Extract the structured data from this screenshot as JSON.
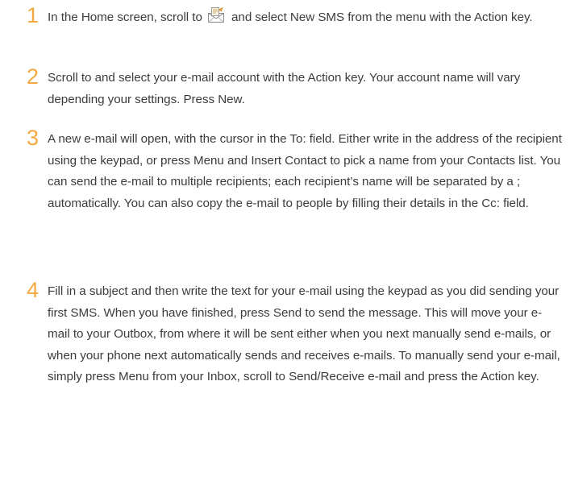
{
  "steps": [
    {
      "number": "1",
      "text_before_icon": "In the Home screen, scroll to",
      "icon": "envelope-icon",
      "text_after_icon": "and select New SMS from the menu with the Action key."
    },
    {
      "number": "2",
      "text": "Scroll to and select your e-mail account with the Action key. Your account name will vary depending your settings. Press New."
    },
    {
      "number": "3",
      "text": "A new e-mail will open, with the cursor in the To: field. Either write in the address of the recipient using the keypad, or press Menu and Insert Contact to pick a name from your Contacts list. You can send the e-mail to multiple recipients; each recipient’s name will be separated by a ; automatically. You can also copy the e-mail to people by filling their details in the Cc: field."
    },
    {
      "number": "4",
      "text": "Fill in a subject and then write the text for your e-mail using the keypad as you did sending your first SMS. When you have finished, press Send to send the message. This will move your e-mail to your Outbox, from where it will be sent either when you next manually send e-mails, or when your phone next automatically sends and receives e-mails. To manually send your e-mail, simply press Menu from your Inbox, scroll to Send/Receive e-mail and press the Action key."
    }
  ],
  "colors": {
    "step_number": "#f3a93f",
    "body_text": "#3c3c3c"
  }
}
